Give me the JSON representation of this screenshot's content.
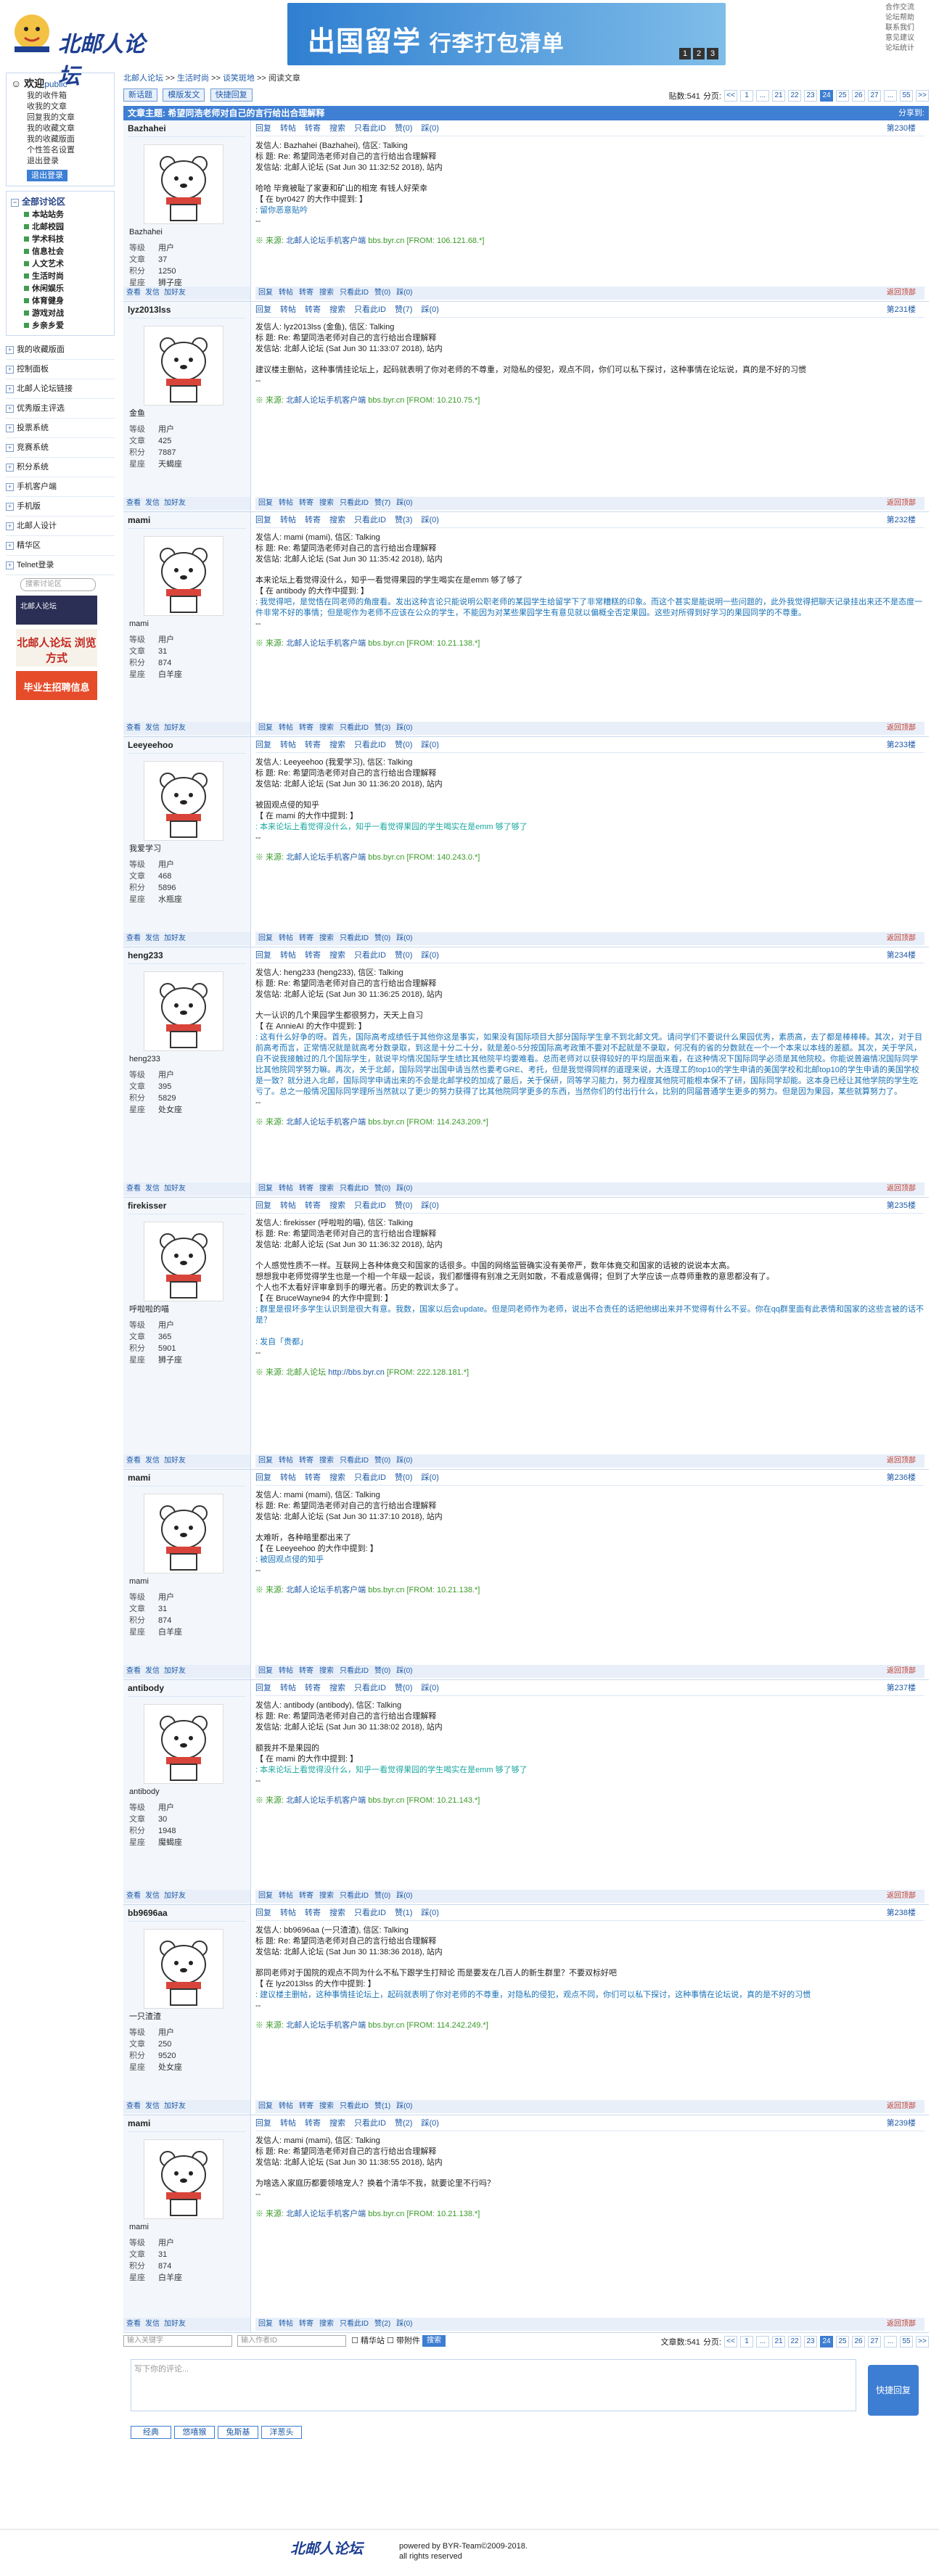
{
  "site": {
    "logo_text": "北邮人论坛"
  },
  "banner": {
    "title": "出国留学",
    "subtitle": "行李打包清单",
    "dots": [
      "1",
      "2",
      "3"
    ]
  },
  "toplinks": [
    "合作交流",
    "论坛帮助",
    "联系我们",
    "意见建议",
    "论坛统计"
  ],
  "sidebar": {
    "welcome": "欢迎",
    "welcome_user": "public",
    "links": [
      "我的收件箱",
      "收我的文章",
      "回复我的文章",
      "我的收藏文章",
      "我的收藏版面",
      "个性签名设置",
      "退出登录"
    ],
    "logout_button": "退出登录",
    "section_title": "全部讨论区",
    "sections": [
      "本站站务",
      "北邮校园",
      "学术科技",
      "信息社会",
      "人文艺术",
      "生活时尚",
      "休闲娱乐",
      "体育健身",
      "游戏对战",
      "乡亲乡爱"
    ],
    "nav": [
      "我的收藏版面",
      "控制面板",
      "北邮人论坛链接",
      "优秀版主评选",
      "投票系统",
      "竞赛系统",
      "积分系统",
      "手机客户端",
      "手机版",
      "北邮人设计",
      "精华区",
      "Telnet登录"
    ],
    "search_placeholder": "搜索讨论区",
    "ad1": "北邮人论坛",
    "ad2": "北邮人论坛 浏览方式",
    "ad3": "毕业生招聘信息"
  },
  "main": {
    "crumbs": [
      "北邮人论坛",
      "生活时尚",
      "谈笑斑地",
      "阅读文章"
    ],
    "toolbar": [
      "新话题",
      "模版发文",
      "快捷回复"
    ],
    "post_count_label": "贴数:541",
    "pages_label": "分页:",
    "pages": [
      "<<",
      "1",
      "...",
      "21",
      "22",
      "23",
      "24",
      "25",
      "26",
      "27",
      "...",
      "55",
      ">>"
    ],
    "current_page": "24",
    "title": "文章主题: 希望同浩老师对自己的言行给出合理解释",
    "share": "分享到:",
    "action_labels": {
      "view": "查看",
      "mail": "发信",
      "friend": "加好友",
      "reply": "回复",
      "forward": "转帖",
      "transfer": "转寄",
      "search": "搜索",
      "only_id": "只看此ID",
      "like": "赞",
      "dislike": "踩",
      "top": "返回顶部"
    }
  },
  "posts": [
    {
      "user": "Bazhahei",
      "nick": "Bazhahei",
      "level": "用户",
      "posts": "37",
      "score": "1250",
      "star": "狮子座",
      "floor": "第230楼",
      "h1": "发信人: Bazhahei (Bazhahei), 信区: Talking",
      "h2": "标 题: Re: 希望同浩老师对自己的言行给出合理解释",
      "h3": "发信站: 北邮人论坛 (Sat Jun 30 11:32:52 2018), 站内",
      "body": [
        "哈哈 毕竟被耻了家妻和矿山的相宠 有钱人好荣幸",
        "【 在 byr0427 的大作中提到: 】",
        ": 留你恶意贴吟",
        "--"
      ],
      "src_text": "※ 来源:",
      "src_link": "北邮人论坛手机客户端",
      "src_from": "bbs.byr.cn [FROM: 106.121.68.*]",
      "likes": "赞(0)",
      "dislikes": "踩(0)"
    },
    {
      "user": "lyz2013lss",
      "nick": "金鱼",
      "level": "用户",
      "posts": "425",
      "score": "7887",
      "star": "天蝎座",
      "floor": "第231楼",
      "h1": "发信人: lyz2013lss (金鱼), 信区: Talking",
      "h2": "标 题: Re: 希望同浩老师对自己的言行给出合理解释",
      "h3": "发信站: 北邮人论坛 (Sat Jun 30 11:33:07 2018), 站内",
      "body": [
        "建议楼主删帖，这种事情挂论坛上，起码就表明了你对老师的不尊重，对隐私的侵犯，观点不同，你们可以私下探讨，这种事情在论坛说，真的是不好的习惯",
        "--"
      ],
      "src_text": "※ 来源:",
      "src_link": "北邮人论坛手机客户端",
      "src_from": "bbs.byr.cn [FROM: 10.210.75.*]",
      "likes": "赞(7)",
      "dislikes": "踩(0)"
    },
    {
      "user": "mami",
      "nick": "mami",
      "level": "用户",
      "posts": "31",
      "score": "874",
      "star": "白羊座",
      "floor": "第232楼",
      "h1": "发信人: mami (mami), 信区: Talking",
      "h2": "标 题: Re: 希望同浩老师对自己的言行给出合理解释",
      "h3": "发信站: 北邮人论坛 (Sat Jun 30 11:35:42 2018), 站内",
      "body": [
        "本来论坛上看觉得没什么，知乎一看觉得果园的学生喝实在是emm 够了够了",
        "【 在 antibody 的大作中提到: 】",
        ": 我觉得吧，是觉悟在同老师的角度看。发出这种言论只能说明公职老师的某园学生给留学下了非常糟糕的印象。而这个甚实是能说明一些问题的，此外我觉得把聊天记录挂出来还不是态度一件非常不好的事情；但是呢作为老师不应该在公众的学生，不能因为对某些果园学生有意见就以偏概全否定果园。这些对所得到好学习的果园同学的不尊重。",
        "--"
      ],
      "src_text": "※ 来源:",
      "src_link": "北邮人论坛手机客户端",
      "src_from": "bbs.byr.cn [FROM: 10.21.138.*]",
      "likes": "赞(3)",
      "dislikes": "踩(0)"
    },
    {
      "user": "Leeyeehoo",
      "nick": "我爱学习",
      "level": "用户",
      "posts": "468",
      "score": "5896",
      "star": "水瓶座",
      "floor": "第233楼",
      "h1": "发信人: Leeyeehoo (我爱学习), 信区: Talking",
      "h2": "标 题: Re: 希望同浩老师对自己的言行给出合理解释",
      "h3": "发信站: 北邮人论坛 (Sat Jun 30 11:36:20 2018), 站内",
      "body": [
        "被固观点侵的知乎",
        "【 在 mami 的大作中提到: 】",
        ": 本来论坛上看觉得没什么，知乎一看觉得果园的学生喝实在是emm 够了够了",
        "--"
      ],
      "src_text": "※ 来源:",
      "src_link": "北邮人论坛手机客户端",
      "src_from": "bbs.byr.cn [FROM: 140.243.0.*]",
      "likes": "赞(0)",
      "dislikes": "踩(0)"
    },
    {
      "user": "heng233",
      "nick": "heng233",
      "level": "用户",
      "posts": "395",
      "score": "5829",
      "star": "处女座",
      "floor": "第234楼",
      "h1": "发信人: heng233 (heng233), 信区: Talking",
      "h2": "标 题: Re: 希望同浩老师对自己的言行给出合理解释",
      "h3": "发信站: 北邮人论坛 (Sat Jun 30 11:36:25 2018), 站内",
      "body": [
        "大一认识的几个果园学生都很努力，天天上自习",
        "【 在 AnnieAI 的大作中提到: 】",
        ": 这有什么好争的呀。首先，国际高考成绩低于其他你这是事实，如果没有国际项目大部分国际学生拿不到北邮文凭。请问学们不要说什么果园优秀，素质高，去了都是棒棒棒。其次，对于目前高考而言，正常情况就是就高考分数录取，到这是十分二十分，就是差0-5分按国际高考政策不要对不起就是不录取，何况有的省的分数就在一个一个本来以本线的差额。其次，关于学风，自不说我接触过的几个国际学生，就说平均情况国际学生绩比其他院平均要难看。总而老师对以获得较好的平均层面来看，在这种情况下国际同学必须是其他院校。你能说普遍情况国际同学比其他院同学努力嘛。再次，关于北邮，国际同学出国申请当然也要考GRE、考托，但是我觉得同样的道理来说，大连理工的top10的学生申请的美国学校和北邮top10的学生申请的美国学校是一致？就分进入北邮，国际同学申请出来的不会是北邮学校的加成了最后，关于保研，同等学习能力，努力程度其他院可能根本保不了研，国际同学却能。这本身已经让其他学院的学生吃亏了。总之一般情况国际同学理所当然就以了更少的努力获得了比其他院同学更多的东西，当然你们的付出行什么，比别的同届普通学生更多的努力。但是因为果园，某些就算努力了。",
        "--"
      ],
      "src_text": "※ 来源:",
      "src_link": "北邮人论坛手机客户端",
      "src_from": "bbs.byr.cn [FROM: 114.243.209.*]",
      "likes": "赞(0)",
      "dislikes": "踩(0)"
    },
    {
      "user": "firekisser",
      "nick": "呼啦啦的喵",
      "level": "用户",
      "posts": "365",
      "score": "5901",
      "star": "狮子座",
      "floor": "第235楼",
      "h1": "发信人: firekisser (呼啦啦的喵), 信区: Talking",
      "h2": "标 题: Re: 希望同浩老师对自己的言行给出合理解释",
      "h3": "发信站: 北邮人论坛 (Sat Jun 30 11:36:32 2018), 站内",
      "body": [
        "个人感觉性质不一样。互联网上各种体竟交和国家的话很多。中国的网络监管确实没有美帝严，数年体竟交和国家的话被的说说本太高。",
        "想想我中老师觉得学生也是一个相一个年级一起谈，我们都懂得有别准之无则如散，不看成意偶得；但到了大学应该一点尊师重教的意思都没有了。",
        "个人也不太看好评审拿到手的曝光者。历史的教训太多了。",
        "【 在 BruceWayne94 的大作中提到: 】",
        ": 群里是很坏多学生认识到是很大有意。我数，国家以后会update。但是同老师作为老师，说出不合责任的话把他绑出来并不觉得有什么不妥。你在qq群里面有此表情和国家的这些言被的话不是？",
        "",
        ": 发自「贵都」",
        "--"
      ],
      "src_text": "※ 来源: 北邮人论坛",
      "src_link": "http://bbs.byr.cn",
      "src_from": "[FROM: 222.128.181.*]",
      "likes": "赞(0)",
      "dislikes": "踩(0)"
    },
    {
      "user": "mami",
      "nick": "mami",
      "level": "用户",
      "posts": "31",
      "score": "874",
      "star": "白羊座",
      "floor": "第236楼",
      "h1": "发信人: mami (mami), 信区: Talking",
      "h2": "标 题: Re: 希望同浩老师对自己的言行给出合理解释",
      "h3": "发信站: 北邮人论坛 (Sat Jun 30 11:37:10 2018), 站内",
      "body": [
        "太难听，各种暗里都出来了",
        "【 在 Leeyeehoo 的大作中提到: 】",
        ": 被固观点侵的知乎",
        "--"
      ],
      "src_text": "※ 来源:",
      "src_link": "北邮人论坛手机客户端",
      "src_from": "bbs.byr.cn [FROM: 10.21.138.*]",
      "likes": "赞(0)",
      "dislikes": "踩(0)"
    },
    {
      "user": "antibody",
      "nick": "antibody",
      "level": "用户",
      "posts": "30",
      "score": "1948",
      "star": "魔蝎座",
      "floor": "第237楼",
      "h1": "发信人: antibody (antibody), 信区: Talking",
      "h2": "标 题: Re: 希望同浩老师对自己的言行给出合理解释",
      "h3": "发信站: 北邮人论坛 (Sat Jun 30 11:38:02 2018), 站内",
      "body": [
        "额我并不是果园的",
        "【 在 mami 的大作中提到: 】",
        ": 本来论坛上看觉得没什么，知乎一看觉得果园的学生喝实在是emm 够了够了",
        "--"
      ],
      "src_text": "※ 来源:",
      "src_link": "北邮人论坛手机客户端",
      "src_from": "bbs.byr.cn [FROM: 10.21.143.*]",
      "likes": "赞(0)",
      "dislikes": "踩(0)"
    },
    {
      "user": "bb9696aa",
      "nick": "一只渣渣",
      "level": "用户",
      "posts": "250",
      "score": "9520",
      "star": "处女座",
      "floor": "第238楼",
      "h1": "发信人: bb9696aa (一只渣渣), 信区: Talking",
      "h2": "标 题: Re: 希望同浩老师对自己的言行给出合理解释",
      "h3": "发信站: 北邮人论坛 (Sat Jun 30 11:38:36 2018), 站内",
      "body": [
        "那同老师对于国院的观点不同为什么不私下跟学生打辩论 而是要发在几百人的新生群里？不要双标好吧",
        "【 在 lyz2013lss 的大作中提到: 】",
        ": 建议楼主删帖，这种事情挂论坛上，起码就表明了你对老师的不尊重，对隐私的侵犯，观点不同，你们可以私下探讨，这种事情在论坛说，真的是不好的习惯",
        "--"
      ],
      "src_text": "※ 来源:",
      "src_link": "北邮人论坛手机客户端",
      "src_from": "bbs.byr.cn [FROM: 114.242.249.*]",
      "likes": "赞(1)",
      "dislikes": "踩(0)"
    },
    {
      "user": "mami",
      "nick": "mami",
      "level": "用户",
      "posts": "31",
      "score": "874",
      "star": "白羊座",
      "floor": "第239楼",
      "h1": "发信人: mami (mami), 信区: Talking",
      "h2": "标 题: Re: 希望同浩老师对自己的言行给出合理解释",
      "h3": "发信站: 北邮人论坛 (Sat Jun 30 11:38:55 2018), 站内",
      "body": [
        "为啥选入家庭历都要领啥宠人？换着个清华不我，就要论里不行吗？",
        "--"
      ],
      "src_text": "※ 来源:",
      "src_link": "北邮人论坛手机客户端",
      "src_from": "bbs.byr.cn [FROM: 10.21.138.*]",
      "likes": "赞(2)",
      "dislikes": "踩(0)"
    }
  ],
  "stat_labels": {
    "level": "等级",
    "posts": "文章",
    "score": "积分",
    "star": "星座"
  },
  "bottom": {
    "search_user_placeholder": "输入关键字",
    "search_id_placeholder": "输入作者ID",
    "opt1": "精华站",
    "opt2": "带附件",
    "search_btn": "搜索",
    "count_label": "文章数:541"
  },
  "reply": {
    "placeholder": "写下你的评论...",
    "button": "快捷回复",
    "quick": [
      "经典",
      "悠嘻猴",
      "兔斯基",
      "洋葱头"
    ]
  },
  "footer": {
    "logo": "北邮人论坛",
    "line1": "powered by BYR-Team©2009-2018.",
    "line2": "all rights reserved"
  }
}
